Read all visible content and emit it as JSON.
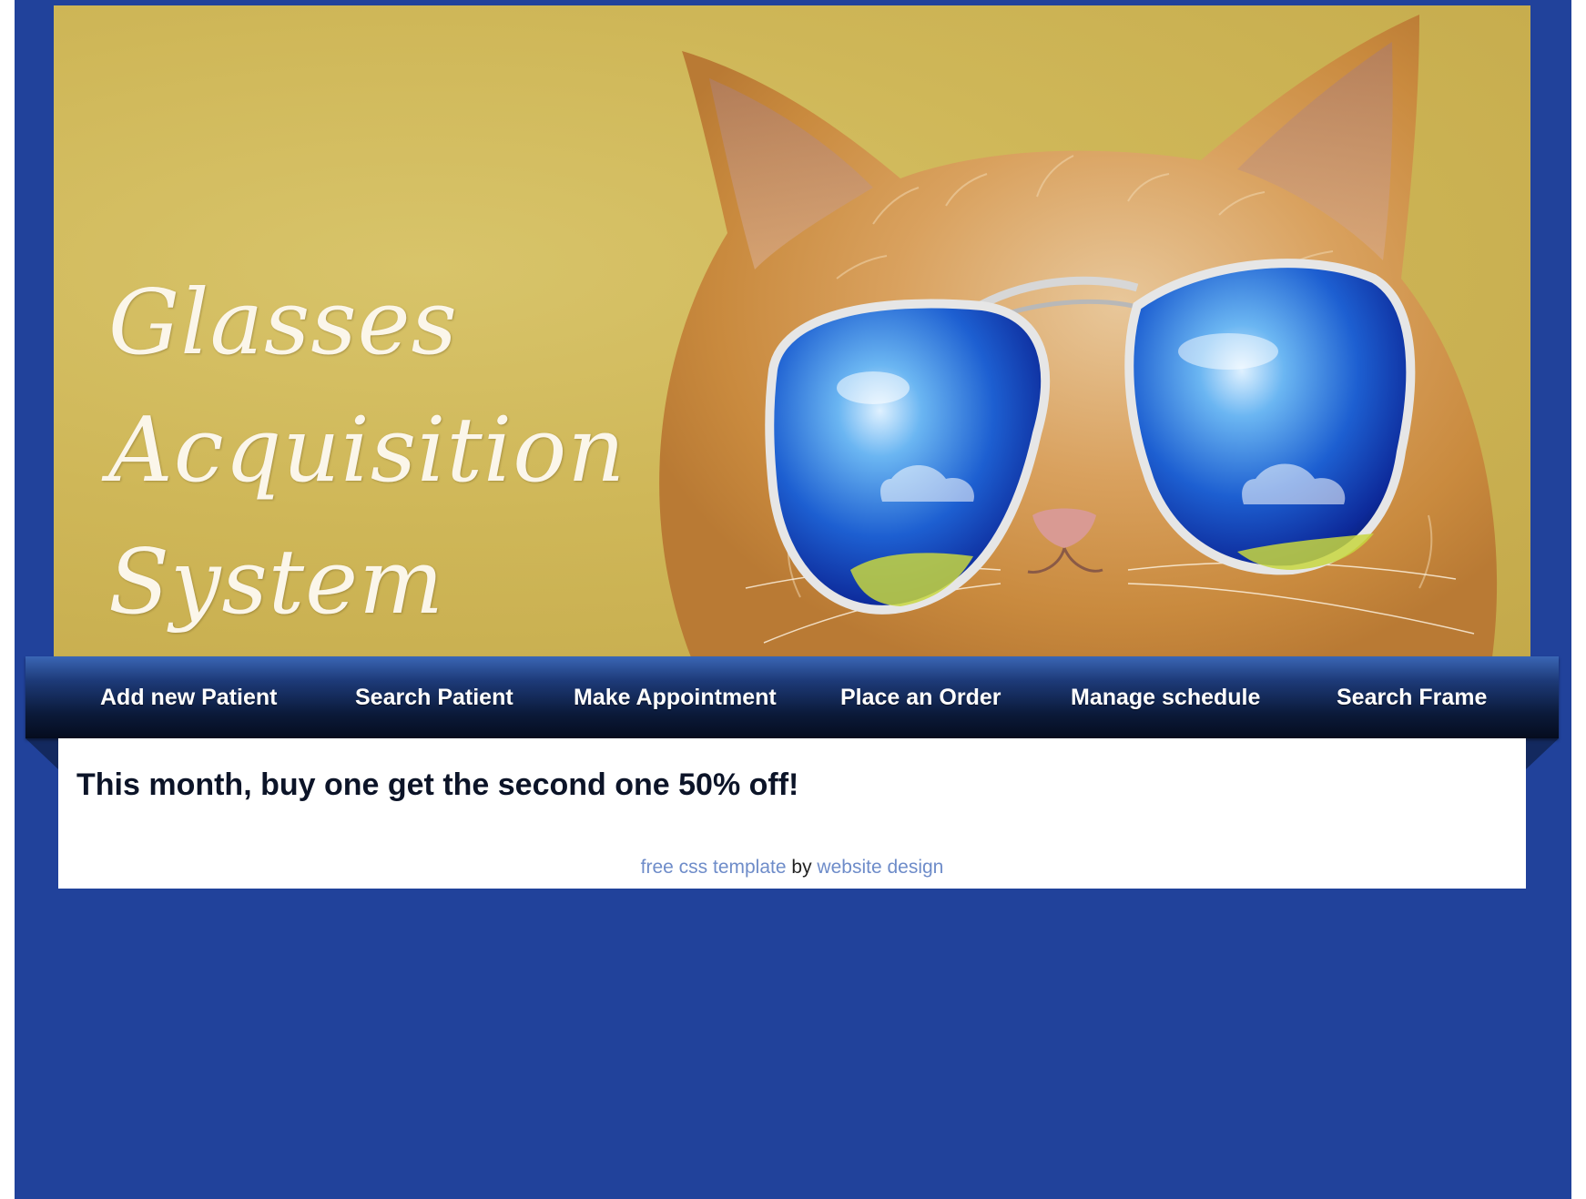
{
  "header": {
    "title_lines": [
      "Glasses",
      "Acquisition",
      "System"
    ]
  },
  "nav": {
    "items": [
      {
        "label": "Add new Patient"
      },
      {
        "label": "Search Patient"
      },
      {
        "label": "Make Appointment"
      },
      {
        "label": "Place an Order"
      },
      {
        "label": "Manage schedule"
      },
      {
        "label": "Search Frame"
      }
    ]
  },
  "content": {
    "promo": "This month, buy one get the second one 50% off!"
  },
  "footer": {
    "link1": "free css template",
    "by": "by",
    "link2": "website design"
  },
  "colors": {
    "page_background": "#21429b",
    "nav_dark": "#050c1e",
    "link": "#6e8cc9"
  },
  "icons": {
    "banner_image": "kitten-with-sunglasses-image"
  }
}
